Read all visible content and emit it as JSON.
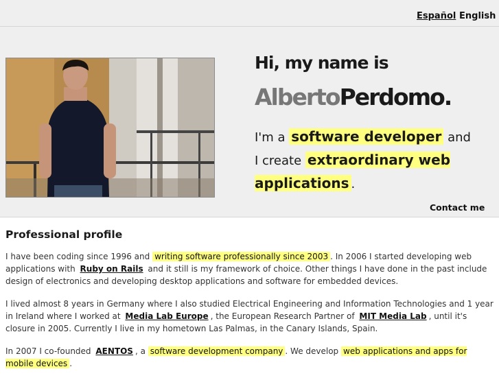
{
  "nav": {
    "lang_es": "Español",
    "lang_en": "English"
  },
  "hero": {
    "greeting": "Hi, my name is",
    "first_name": "Alberto",
    "last_name": "Perdomo.",
    "tagline_1": "I'm a",
    "tagline_hl1": "software developer",
    "tagline_2": "and I create",
    "tagline_hl2": "extraordinary web applications",
    "tagline_3": ".",
    "contact": "Contact me"
  },
  "profile": {
    "title": "Professional profile",
    "p1_a": "I have been coding since 1996 and",
    "p1_hl": "writing software professionally since 2003",
    "p1_b": ". In 2006 I started developing web applications with",
    "p1_link": "Ruby on Rails",
    "p1_c": "and it still is my framework of choice. Other things I have done in the past include design of electronics and developing desktop applications and software for embedded devices.",
    "p2_a": "I lived almost 8 years in Germany where I also studied Electrical Engineering and Information Technologies and 1 year in Ireland where I worked at",
    "p2_link1": "Media Lab Europe",
    "p2_b": ", the European Research Partner of",
    "p2_link2": "MIT Media Lab",
    "p2_c": ", until it's closure in 2005. Currently I live in my hometown Las Palmas, in the Canary Islands, Spain.",
    "p3_a": "In 2007 I co-founded",
    "p3_link": "AENTOS",
    "p3_b": ", a",
    "p3_hl1": "software development company",
    "p3_c": ". We develop",
    "p3_hl2": "web applications and apps for mobile devices",
    "p3_d": "."
  },
  "colors": {
    "highlight": "#ffff80",
    "band": "#efefef"
  }
}
